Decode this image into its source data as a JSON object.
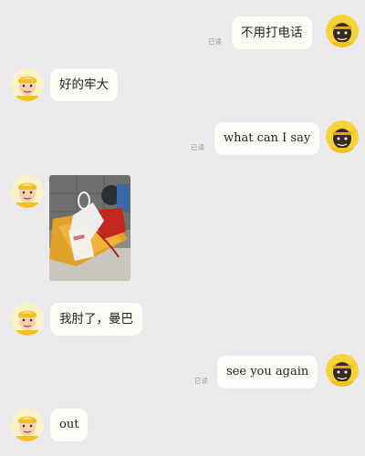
{
  "messages": [
    {
      "side": "right",
      "avatar": "dark-helmet-avatar",
      "text": "不用打电话",
      "read_label": "已读"
    },
    {
      "side": "left",
      "avatar": "yellow-cap-avatar",
      "text": "好的牢大"
    },
    {
      "side": "right",
      "avatar": "dark-helmet-avatar",
      "text": "what can I say",
      "read_label": "已读"
    },
    {
      "side": "left",
      "avatar": "yellow-cap-avatar",
      "type": "image",
      "image_desc": "photo-of-bags-on-stool"
    },
    {
      "side": "left",
      "avatar": "yellow-cap-avatar",
      "text": "我肘了，曼巴"
    },
    {
      "side": "right",
      "avatar": "dark-helmet-avatar",
      "text": "see you again",
      "read_label": "已读"
    },
    {
      "side": "left",
      "avatar": "yellow-cap-avatar",
      "text": "out"
    }
  ],
  "colors": {
    "background": "#edeaed",
    "bubble": "#fdfcf7",
    "read_label": "#9a9a9a",
    "avatar_yellow": "#f2c21a"
  }
}
